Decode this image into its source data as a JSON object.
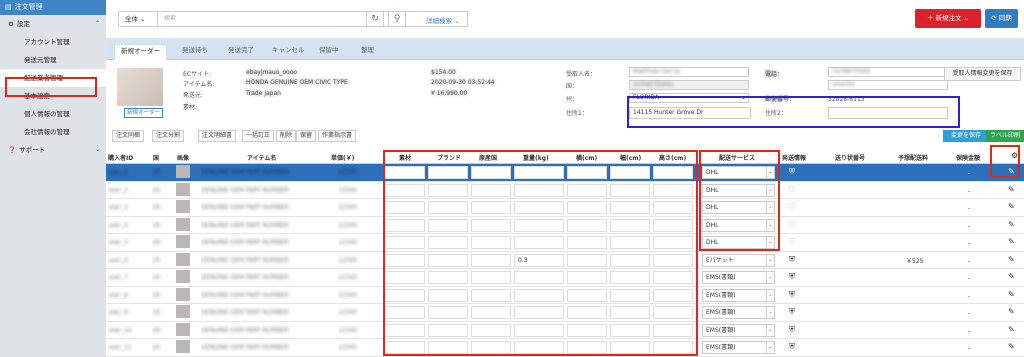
{
  "sidebar": {
    "header": "注文管理",
    "items": [
      {
        "label": "設定",
        "level": 0,
        "chevron": "⌃"
      },
      {
        "label": "アカウント管理",
        "level": 1
      },
      {
        "label": "発送元管理",
        "level": 1
      },
      {
        "label": "配送業者管理",
        "level": 1,
        "selected": true
      },
      {
        "label": "基本設定",
        "level": 1
      },
      {
        "label": "個人情報の管理",
        "level": 1
      },
      {
        "label": "会社情報の管理",
        "level": 1
      },
      {
        "label": "サポート",
        "level": 0,
        "chevron": "⌄"
      }
    ]
  },
  "topbar": {
    "filter": "全体",
    "search_placeholder": "検索",
    "advanced": "詳細検索",
    "new_order": "新規注文",
    "sync": "同期"
  },
  "tabs": [
    "新規オーダー",
    "発送待ち",
    "発送完了",
    "キャンセル",
    "保留中",
    "整理"
  ],
  "info": {
    "new_order_badge": "新規オーダー",
    "ec_label": "ECサイト:",
    "item_label": "アイテム名:",
    "from_label": "発送元:",
    "material_label": "素材:",
    "recipient_label": "受取人名：",
    "country_label": "国：",
    "state_label": "州：",
    "state_value": "FLORIDA",
    "addr1_label": "住所1：",
    "addr1_value": "14115 Hunter Grove Dr",
    "addr2_label": "住所2：",
    "zip_value": "32828-6113",
    "update_btn": "受取人情報変更を保存",
    "right_label1": "電話：",
    "right_label2": "郵便番号："
  },
  "toolbar": {
    "buttons": [
      "注文同梱",
      "注文分割",
      "注文明細書",
      "一括訂正",
      "削除",
      "保留",
      "作業指示書"
    ],
    "save": "変更を保存",
    "label_print": "ラベル印刷"
  },
  "columns": {
    "buyer": "購入者ID",
    "country": "国",
    "image": "画像",
    "item": "アイテム名",
    "price": "単価(￥)",
    "material": "素材",
    "brand": "ブランド",
    "origin": "原産国",
    "weight": "重量(kg)",
    "width": "横(cm)",
    "depth": "幅(cm)",
    "height": "高さ(cm)",
    "service": "配送サービス",
    "ship_info": "発送情報",
    "tracking": "送り状番号",
    "est_fee": "予想配送料",
    "insurance": "保険金額",
    "gear": "⚙"
  },
  "rows": [
    {
      "service": "DHL",
      "weight": "",
      "fee": "",
      "ins": "-",
      "ship_icon": true,
      "selected": true
    },
    {
      "service": "DHL",
      "weight": "",
      "fee": "",
      "ins": "-",
      "ship_icon": false
    },
    {
      "service": "DHL",
      "weight": "",
      "fee": "",
      "ins": "-",
      "ship_icon": false
    },
    {
      "service": "DHL",
      "weight": "",
      "fee": "",
      "ins": "-",
      "ship_icon": false
    },
    {
      "service": "DHL",
      "weight": "",
      "fee": "",
      "ins": "-",
      "ship_icon": false
    },
    {
      "service": "Eパケット",
      "weight": "0.3",
      "fee": "￥525",
      "ins": "-",
      "ship_icon": true
    },
    {
      "service": "EMS(書類)",
      "weight": "",
      "fee": "",
      "ins": "-",
      "ship_icon": true
    },
    {
      "service": "EMS(書類)",
      "weight": "",
      "fee": "",
      "ins": "-",
      "ship_icon": true
    },
    {
      "service": "EMS(書類)",
      "weight": "",
      "fee": "",
      "ins": "-",
      "ship_icon": true
    },
    {
      "service": "EMS(書類)",
      "weight": "",
      "fee": "",
      "ins": "-",
      "ship_icon": true
    },
    {
      "service": "EMS(書類)",
      "weight": "",
      "fee": "",
      "ins": "-",
      "ship_icon": true
    }
  ],
  "colors": {
    "accent": "#3f84c5",
    "danger": "#d9232d",
    "highlight": "#e0261d",
    "blue_box": "#2b21d9"
  }
}
